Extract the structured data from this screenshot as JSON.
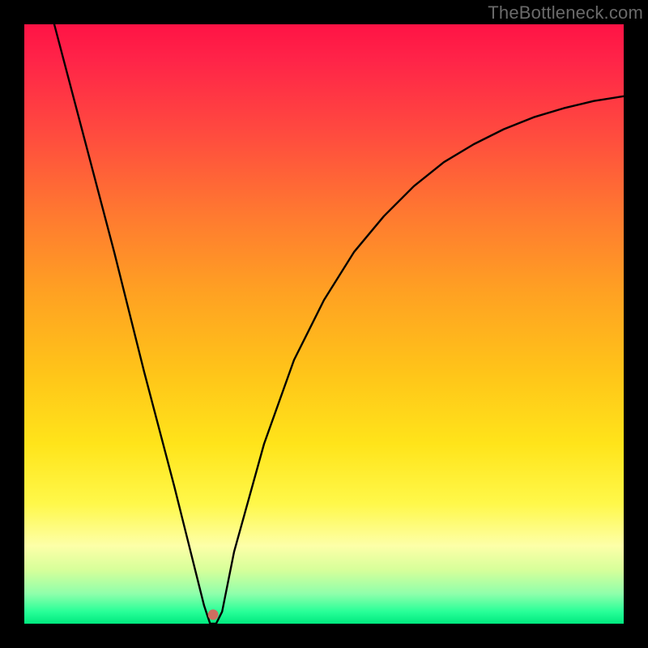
{
  "watermark": "TheBottleneck.com",
  "chart_data": {
    "type": "line",
    "title": "",
    "xlabel": "",
    "ylabel": "",
    "xlim": [
      0,
      100
    ],
    "ylim": [
      0,
      100
    ],
    "grid": false,
    "legend": false,
    "series": [
      {
        "name": "bottleneck-curve",
        "x": [
          5,
          10,
          15,
          20,
          25,
          27,
          30,
          31,
          32,
          33,
          35,
          40,
          45,
          50,
          55,
          60,
          65,
          70,
          75,
          80,
          85,
          90,
          95,
          100
        ],
        "values": [
          100,
          81,
          62,
          42,
          23,
          15,
          3,
          0,
          0,
          2,
          12,
          30,
          44,
          54,
          62,
          68,
          73,
          77,
          80,
          82.5,
          84.5,
          86,
          87.2,
          88
        ]
      }
    ],
    "annotations": [
      {
        "type": "point",
        "x": 31.5,
        "y": 1.5,
        "label": "minimum-marker"
      }
    ],
    "background_gradient": {
      "top": "#ff1345",
      "upper_mid": "#ffa222",
      "mid": "#ffe41a",
      "lower_mid": "#fff84a",
      "bottom": "#00e97f"
    }
  }
}
